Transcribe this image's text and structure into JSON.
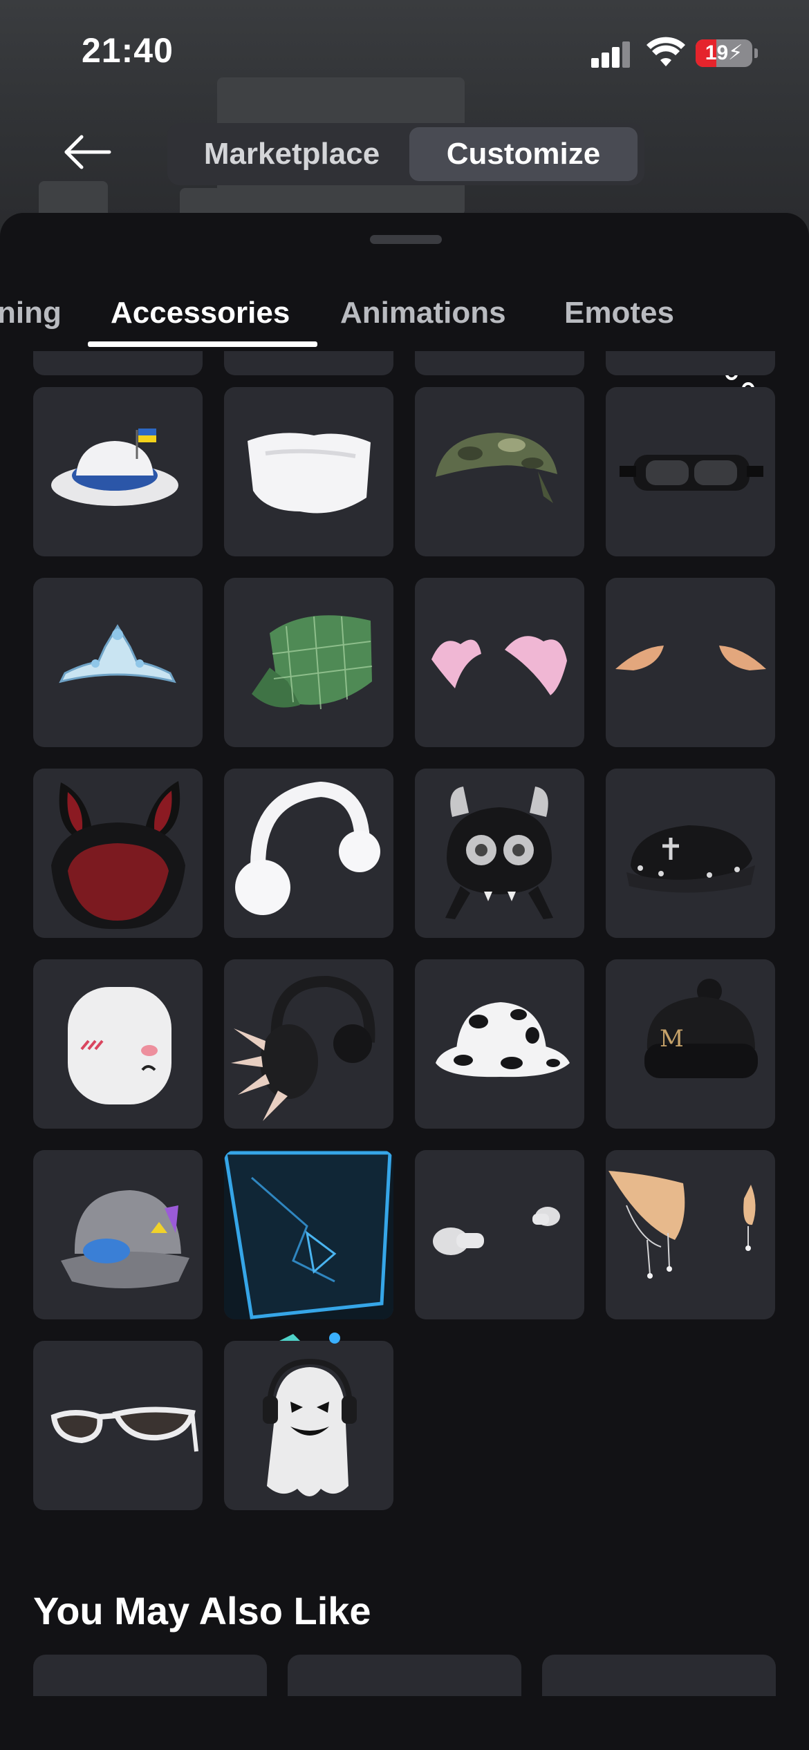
{
  "status_bar": {
    "time": "21:40",
    "battery_level": "19",
    "battery_color": "#e5242c",
    "icons": [
      "signal-icon",
      "wifi-icon",
      "battery-charging-icon"
    ]
  },
  "header": {
    "back_icon": "arrow-left-icon",
    "tabs": [
      {
        "label": "Marketplace",
        "selected": false
      },
      {
        "label": "Customize",
        "selected": true
      }
    ]
  },
  "category_tabs": {
    "items": [
      {
        "label": "ning",
        "selected": false
      },
      {
        "label": "Accessories",
        "selected": true
      },
      {
        "label": "Animations",
        "selected": false
      },
      {
        "label": "Emotes",
        "selected": false
      }
    ],
    "filter_icon": "sliders-icon"
  },
  "accessories": [
    "white-fedora-with-flag",
    "white-fluffy-hat",
    "camo-bandana",
    "black-goggles",
    "silver-tiara",
    "green-plaid-cap",
    "pink-bows",
    "elf-ears",
    "red-bunny-ear-hood",
    "white-earmuffs",
    "black-monster-hat",
    "black-spiked-beret",
    "white-blush-head",
    "spiked-headphones",
    "cow-print-bucket-hat",
    "black-knit-beanie",
    "grey-hard-hat",
    "blue-glowing-cube",
    "white-earbuds",
    "jeweled-elf-ears",
    "white-sunglasses",
    "ghost-with-headphones"
  ],
  "recommendations": {
    "title": "You May Also Like"
  }
}
